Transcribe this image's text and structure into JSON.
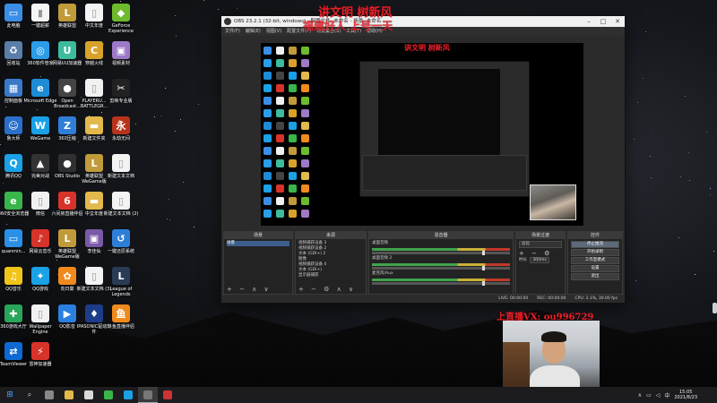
{
  "overlays": {
    "top_title": "讲文明 树新风",
    "top_sub": "福建好人 上号一天",
    "preview_title": "讲文明 树新风",
    "contact": "上直播VX: ou996729"
  },
  "desktop_icons": [
    {
      "label": "此电脑",
      "color": "#3a8ee6",
      "glyph": "▭"
    },
    {
      "label": "一键超薪",
      "color": "#f5f5f5",
      "glyph": "▮"
    },
    {
      "label": "英雄联盟",
      "color": "#c19a3a",
      "glyph": "L"
    },
    {
      "label": "中文年度",
      "color": "#f4f4f4",
      "glyph": "▯"
    },
    {
      "label": "GeForce Experience",
      "color": "#6dbb2d",
      "glyph": "◆"
    },
    {
      "label": "回收站",
      "color": "#5a7ea8",
      "glyph": "♻"
    },
    {
      "label": "360软件管家",
      "color": "#2b9de8",
      "glyph": "◎"
    },
    {
      "label": "网易UU加速器",
      "color": "#3dbb9d",
      "glyph": "U"
    },
    {
      "label": "穿越火线",
      "color": "#d8a22a",
      "glyph": "C"
    },
    {
      "label": "视频素材",
      "color": "#9e79c7",
      "glyph": "▣"
    },
    {
      "label": "控制面板",
      "color": "#3a79c7",
      "glyph": "▦"
    },
    {
      "label": "Microsoft Edge",
      "color": "#1e8bd6",
      "glyph": "e"
    },
    {
      "label": "Open Broadcast...",
      "color": "#444",
      "glyph": "●"
    },
    {
      "label": "PLAYERU... BATTLEGR...",
      "color": "#f1f1f1",
      "glyph": "▯"
    },
    {
      "label": "剪映专业版",
      "color": "#222",
      "glyph": "✂"
    },
    {
      "label": "鲁大师",
      "color": "#2a6fc9",
      "glyph": "☺"
    },
    {
      "label": "WeGame",
      "color": "#19a0e6",
      "glyph": "W"
    },
    {
      "label": "360压缩",
      "color": "#2f7ed8",
      "glyph": "Z"
    },
    {
      "label": "新建文件夹",
      "color": "#e2b94a",
      "glyph": "▬"
    },
    {
      "label": "永劫无间",
      "color": "#b8331c",
      "glyph": "永"
    },
    {
      "label": "腾讯QQ",
      "color": "#1aa1e6",
      "glyph": "Q"
    },
    {
      "label": "完美对战",
      "color": "#333",
      "glyph": "▲"
    },
    {
      "label": "OBS Studio",
      "color": "#303030",
      "glyph": "●"
    },
    {
      "label": "英雄联盟 WeGame版",
      "color": "#c19a3a",
      "glyph": "L"
    },
    {
      "label": "新建文本文档",
      "color": "#f3f3f3",
      "glyph": "▯"
    },
    {
      "label": "360安全浏览器",
      "color": "#39b54a",
      "glyph": "e"
    },
    {
      "label": "微信",
      "color": "#f0f0f0",
      "glyph": "▯"
    },
    {
      "label": "六间房直播伴侣",
      "color": "#d8332a",
      "glyph": "6"
    },
    {
      "label": "中文年度",
      "color": "#e2b94a",
      "glyph": "▬"
    },
    {
      "label": "新建文本文档 (2)",
      "color": "#f3f3f3",
      "glyph": "▯"
    },
    {
      "label": "quanmin...",
      "color": "#2a8fe6",
      "glyph": "▭"
    },
    {
      "label": "网易云音乐",
      "color": "#d8332a",
      "glyph": "♪"
    },
    {
      "label": "英雄联盟 WeGame版",
      "color": "#c19a3a",
      "glyph": "L"
    },
    {
      "label": "李佳仙",
      "color": "#7a5aa8",
      "glyph": "▣"
    },
    {
      "label": "一键还原系统",
      "color": "#2e7ed8",
      "glyph": "↺"
    },
    {
      "label": "QQ音乐",
      "color": "#f0c419",
      "glyph": "♫"
    },
    {
      "label": "QQ游戏",
      "color": "#1aa1e6",
      "glyph": "✦"
    },
    {
      "label": "向日葵",
      "color": "#f08a1c",
      "glyph": "✿"
    },
    {
      "label": "新建文本文档 (3)",
      "color": "#f3f3f3",
      "glyph": "▯"
    },
    {
      "label": "League of Legends",
      "color": "#2a3b56",
      "glyph": "L"
    },
    {
      "label": "360游戏大厅",
      "color": "#2aa55c",
      "glyph": "✚"
    },
    {
      "label": "Wallpaper Engine",
      "color": "#f1f1f1",
      "glyph": "▯"
    },
    {
      "label": "QQ影音",
      "color": "#2b7fe0",
      "glyph": "▶"
    },
    {
      "label": "IPASONIC驱动软件",
      "color": "#1d3d8a",
      "glyph": "♦"
    },
    {
      "label": "斗鱼直播伴侣",
      "color": "#f08a1c",
      "glyph": "鱼"
    },
    {
      "label": "TeamViewer",
      "color": "#0e6ad2",
      "glyph": "⇄"
    },
    {
      "label": "雷神加速器",
      "color": "#d8332a",
      "glyph": "⚡"
    }
  ],
  "obs": {
    "title": "OBS 23.2.1 (32-bit, windows) - 配置文件: 未命名 - 场景: 未命名",
    "menu": [
      "文件(F)",
      "编辑(E)",
      "视图(V)",
      "配置文件(P)",
      "场景集合(S)",
      "工具(T)",
      "帮助(H)"
    ],
    "docks": {
      "scenes": {
        "title": "场景",
        "items": [
          "场景"
        ]
      },
      "sources": {
        "title": "来源",
        "items": [
          "视频捕获设备 3",
          "视频捕获设备 2",
          "文本 (GDI+) 2",
          "图像",
          "视频捕获设备 4",
          "文本 (GDI+)",
          "显示器捕获"
        ]
      },
      "mixer": {
        "title": "混音器",
        "tracks": [
          {
            "name": "桌面音频"
          },
          {
            "name": "桌面音频 2"
          },
          {
            "name": "麦克风/Aux"
          }
        ]
      },
      "transitions": {
        "title": "场景过渡",
        "type": "淡化",
        "duration_label": "时长",
        "duration": "300ms"
      },
      "controls": {
        "title": "控件",
        "buttons": [
          "停止推流",
          "开始录制",
          "工作室模式",
          "设置",
          "退出"
        ]
      }
    },
    "status": {
      "live": "LIVE: 00:00:00",
      "rec": "REC: 00:00:00",
      "cpu": "CPU: 2.1%, 30.00 fps"
    }
  },
  "taskbar": {
    "items": [
      {
        "name": "windows-start",
        "color": "#4aa3ff",
        "active": false
      },
      {
        "name": "search",
        "color": "#666",
        "active": false
      },
      {
        "name": "task-view",
        "color": "#888",
        "active": false
      },
      {
        "name": "file-explorer",
        "color": "#e2b94a",
        "active": false
      },
      {
        "name": "store",
        "color": "#d9d9d9",
        "active": false
      },
      {
        "name": "360-browser",
        "color": "#39b54a",
        "active": false
      },
      {
        "name": "qq",
        "color": "#1aa1e6",
        "active": false
      },
      {
        "name": "obs",
        "color": "#777",
        "active": true
      },
      {
        "name": "photos",
        "color": "#c33",
        "active": false
      }
    ],
    "time": "15:05",
    "date": "2021/8/23"
  }
}
